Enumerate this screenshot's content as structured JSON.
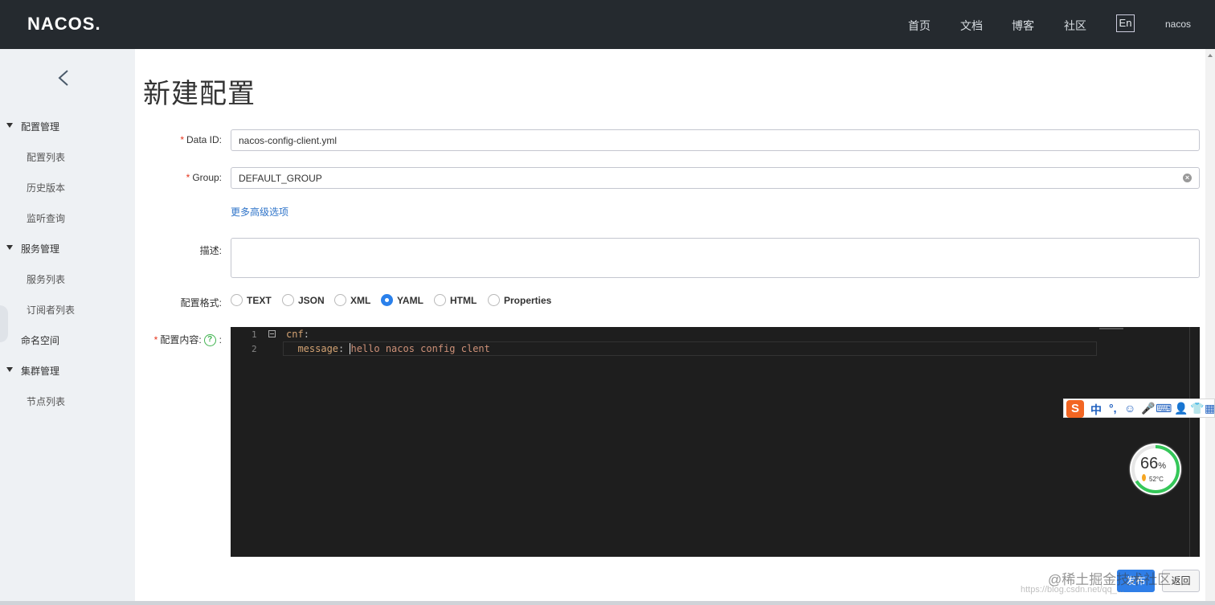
{
  "header": {
    "logo": "NACOS.",
    "nav": [
      "首页",
      "文档",
      "博客",
      "社区"
    ],
    "lang": "En",
    "user": "nacos"
  },
  "sidebar": {
    "groups": [
      {
        "label": "配置管理",
        "items": [
          "配置列表",
          "历史版本",
          "监听查询"
        ]
      },
      {
        "label": "服务管理",
        "items": [
          "服务列表",
          "订阅者列表"
        ]
      },
      {
        "label": "命名空间",
        "items": []
      },
      {
        "label": "集群管理",
        "items": [
          "节点列表"
        ]
      }
    ]
  },
  "page": {
    "title": "新建配置"
  },
  "form": {
    "data_id_label": "Data ID:",
    "data_id_value": "nacos-config-client.yml",
    "group_label": "Group:",
    "group_value": "DEFAULT_GROUP",
    "advanced_link": "更多高级选项",
    "desc_label": "描述:",
    "desc_value": "",
    "format_label": "配置格式:",
    "formats": [
      "TEXT",
      "JSON",
      "XML",
      "YAML",
      "HTML",
      "Properties"
    ],
    "selected_format": "YAML",
    "content_label": "配置内容:",
    "help_glyph": "?",
    "content_colon": ":",
    "required_mark": "*"
  },
  "editor": {
    "lines": [
      {
        "num": "1",
        "key": "cnf",
        "sep": ":",
        "value": ""
      },
      {
        "num": "2",
        "key": "  message",
        "sep": ": ",
        "value": "hello nacos config clent"
      }
    ]
  },
  "buttons": {
    "publish": "发布",
    "back": "返回"
  },
  "overlays": {
    "ime_items": [
      "中",
      "°,",
      "☺",
      "🎤",
      "⌨",
      "👤",
      "👕",
      "▦"
    ],
    "ime_logo": "S",
    "gauge_percent": "66",
    "gauge_percent_sign": "%",
    "gauge_percent_value": 0.66,
    "gauge_temp": "52°C",
    "watermark": "@稀土掘金技术社区",
    "watermark_url": "https://blog.csdn.net/qq_..."
  }
}
